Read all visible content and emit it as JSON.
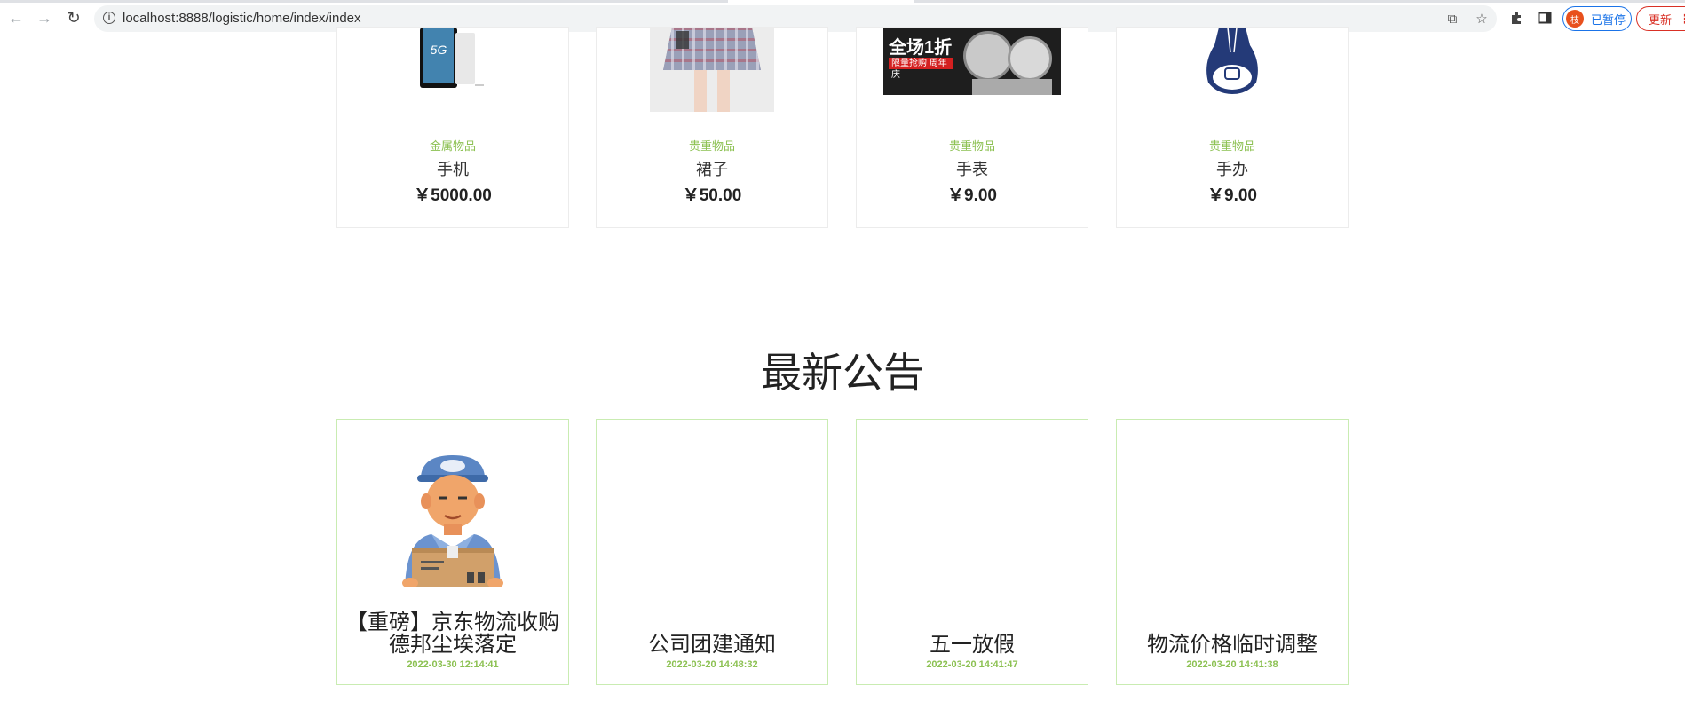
{
  "browser": {
    "url": "localhost:8888/logistic/home/index/index",
    "profile_initial": "枝",
    "profile_label": "已暂停",
    "update_label": "更新"
  },
  "products": [
    {
      "category": "金属物品",
      "name": "手机",
      "price": "￥5000.00"
    },
    {
      "category": "贵重物品",
      "name": "裙子",
      "price": "￥50.00"
    },
    {
      "category": "贵重物品",
      "name": "手表",
      "price": "￥9.00"
    },
    {
      "category": "贵重物品",
      "name": "手办",
      "price": "￥9.00"
    }
  ],
  "watch_ad": {
    "line1": "全场1折",
    "line2": "限量抢购",
    "line3": "周年庆"
  },
  "notices_section": {
    "title": "最新公告"
  },
  "notices": [
    {
      "title": "【重磅】京东物流收购德邦尘埃落定",
      "date": "2022-03-30 12:14:41"
    },
    {
      "title": "公司团建通知",
      "date": "2022-03-20 14:48:32"
    },
    {
      "title": "五一放假",
      "date": "2022-03-20 14:41:47"
    },
    {
      "title": "物流价格临时调整",
      "date": "2022-03-20 14:41:38"
    }
  ],
  "colors": {
    "accent_green": "#8cc152",
    "notice_border": "#c9ecb2",
    "card_border": "#ececec",
    "profile_blue": "#1a73e8",
    "update_red": "#d93025"
  }
}
